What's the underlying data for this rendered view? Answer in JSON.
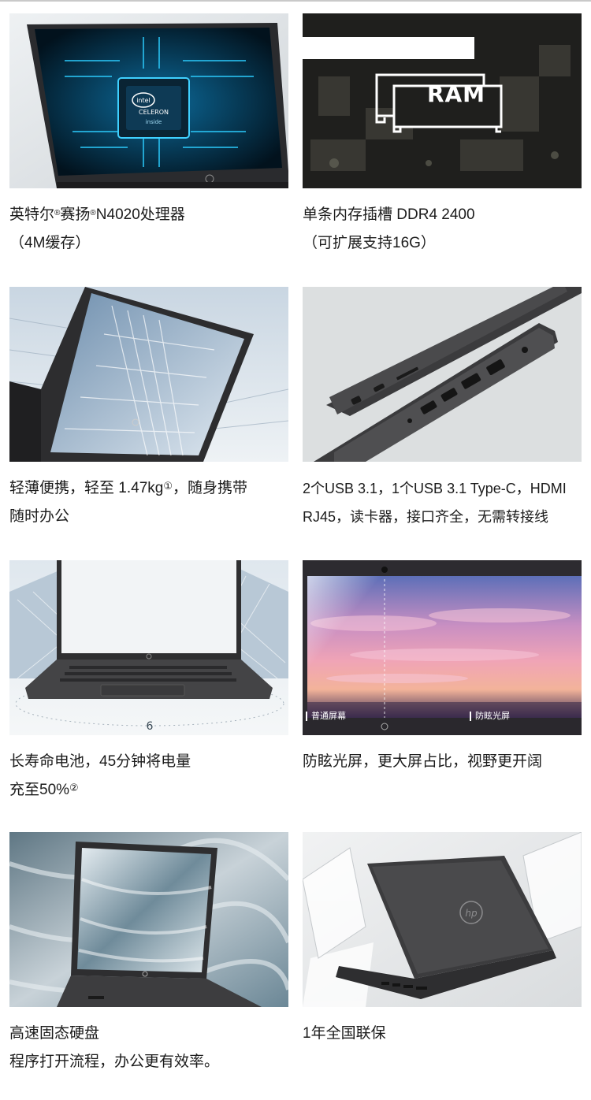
{
  "features": [
    {
      "image_icon": "intel-celeron-chip-laptop",
      "chip_badge": {
        "brand": "intel",
        "product": "CELERON",
        "sub": "inside"
      },
      "line1_a": "英特尔",
      "line1_b": "赛扬",
      "line1_c": "N4020处理器",
      "line2": "（4M缓存）"
    },
    {
      "image_icon": "ram-memory-module",
      "ram_label": "RAM",
      "line1": "单条内存插槽 DDR4 2400",
      "line2": "（可扩展支持16G）"
    },
    {
      "image_icon": "laptop-building-reflection",
      "line1_a": "轻薄便携，轻至 1.47kg",
      "line1_note": "①",
      "line1_b": "，随身携带",
      "line2": "随时办公"
    },
    {
      "image_icon": "laptop-side-ports",
      "line1": "2个USB 3.1，1个USB 3.1 Type-C，HDMI",
      "line2": "RJ45，读卡器，接口齐全，无需转接线"
    },
    {
      "image_icon": "laptop-battery-clock",
      "line1": "长寿命电池，45分钟将电量",
      "line2_a": "充至50%",
      "line2_note": "②",
      "clock_number": "6"
    },
    {
      "image_icon": "antiglare-screen-comparison",
      "label_left": "普通屏幕",
      "label_right": "防眩光屏",
      "line1": "防眩光屏，更大屏占比，视野更开阔"
    },
    {
      "image_icon": "laptop-ssd-swirl",
      "line1": "高速固态硬盘",
      "line2": "程序打开流程，办公更有效率。"
    },
    {
      "image_icon": "laptop-back-hp-logo",
      "line1": "1年全国联保"
    }
  ],
  "colors": {
    "laptop_dark": "#3a3a3c",
    "chip_blue": "#1bb6e8",
    "ram_bg": "#1e1e1e",
    "sky_pink": "#e88bb3",
    "sky_purple": "#6a5fb0"
  }
}
